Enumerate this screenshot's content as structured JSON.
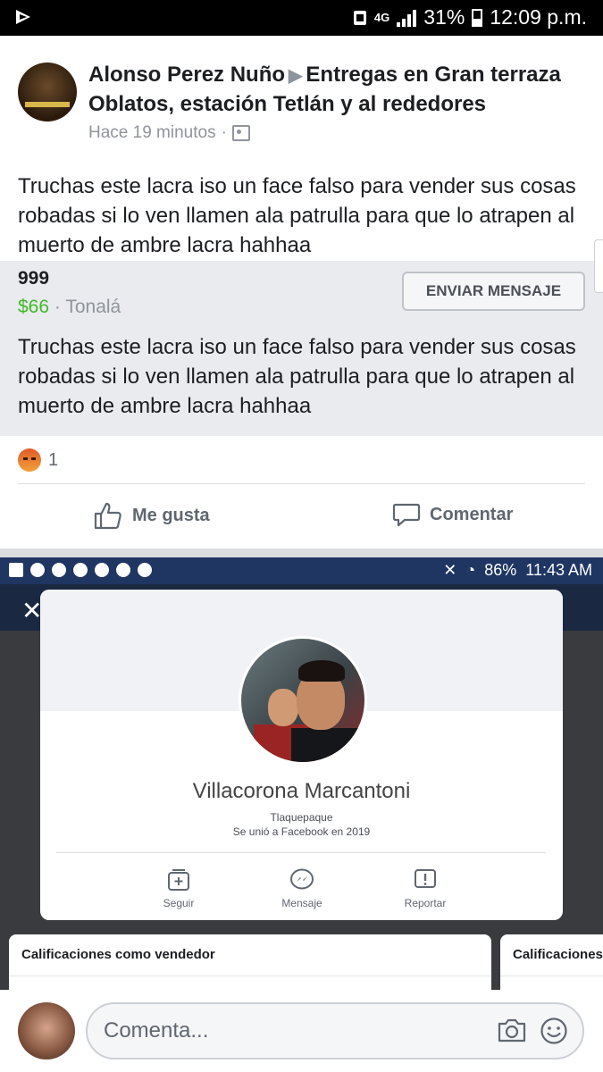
{
  "status_bar": {
    "network": "4G",
    "battery": "31%",
    "time": "12:09 p.m."
  },
  "post": {
    "author": "Alonso Perez Nuño",
    "group": "Entregas en Gran terraza Oblatos, estación Tetlán y al rededores",
    "time_ago": "Hace 19 minutos",
    "separator": "·",
    "text": "Truchas este lacra iso un face falso para vender sus cosas robadas si lo ven llamen ala patrulla para que lo atrapen al muerto de ambre lacra hahhaa"
  },
  "listing": {
    "title": "999",
    "price": "$66",
    "separator": " · ",
    "location": "Tonalá",
    "button": "ENVIAR MENSAJE",
    "description": "Truchas este lacra iso un face falso para vender sus cosas robadas si lo ven llamen ala patrulla para que lo atrapen al muerto de ambre lacra hahhaa"
  },
  "reactions": {
    "icon": "angry-reaction-icon",
    "count": "1"
  },
  "actions": {
    "like": "Me gusta",
    "comment": "Comentar"
  },
  "embedded_screenshot": {
    "status": {
      "battery": "86%",
      "time": "11:43 AM"
    },
    "profile": {
      "name": "Villacorona Marcantoni",
      "city": "Tlaquepaque",
      "joined": "Se unió a Facebook en 2019",
      "actions": [
        "Seguir",
        "Mensaje",
        "Reportar"
      ]
    },
    "ratings_left": "Calificaciones como vendedor",
    "ratings_right": "Calificaciones"
  },
  "comment_bar": {
    "placeholder": "Comenta..."
  },
  "colors": {
    "price_green": "#42b72a",
    "meta_gray": "#90949c",
    "listing_bg": "#e9ebee",
    "embedded_statusbar": "#1f3562"
  }
}
